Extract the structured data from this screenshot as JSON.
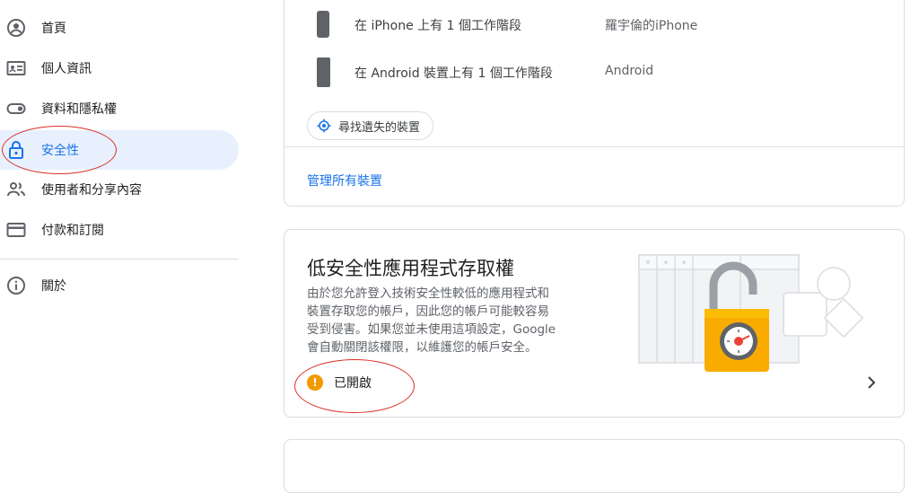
{
  "sidebar": {
    "items": [
      {
        "label": "首頁",
        "icon": "account-circle-icon"
      },
      {
        "label": "個人資訊",
        "icon": "id-card-icon"
      },
      {
        "label": "資料和隱私權",
        "icon": "toggle-icon"
      },
      {
        "label": "安全性",
        "icon": "lock-icon",
        "active": true
      },
      {
        "label": "使用者和分享內容",
        "icon": "people-icon"
      },
      {
        "label": "付款和訂閱",
        "icon": "credit-card-icon"
      },
      {
        "label": "關於",
        "icon": "info-icon"
      }
    ]
  },
  "devices": {
    "rows": [
      {
        "text": "在 iPhone 上有 1 個工作階段",
        "name": "羅宇倫的iPhone",
        "icon": "iphone-icon"
      },
      {
        "text": "在 Android 裝置上有 1 個工作階段",
        "name": "Android",
        "icon": "android-phone-icon"
      }
    ],
    "find_button": "尋找遺失的裝置",
    "manage_link": "管理所有裝置"
  },
  "less_secure": {
    "title": "低安全性應用程式存取權",
    "desc_lines": [
      "由於您允許登入技術安全性較低的應用程式和",
      "裝置存取您的帳戶，因此您的帳戶可能較容易",
      "受到侵害。如果您並未使用這項設定，Google",
      "會自動關閉該權限，以維護您的帳戶安全。"
    ],
    "status": "已開啟",
    "status_icon": "!"
  },
  "colors": {
    "accent": "#1a73e8",
    "active_bg": "#e8f0fe",
    "warning": "#f29900",
    "annotation": "#d93025"
  }
}
